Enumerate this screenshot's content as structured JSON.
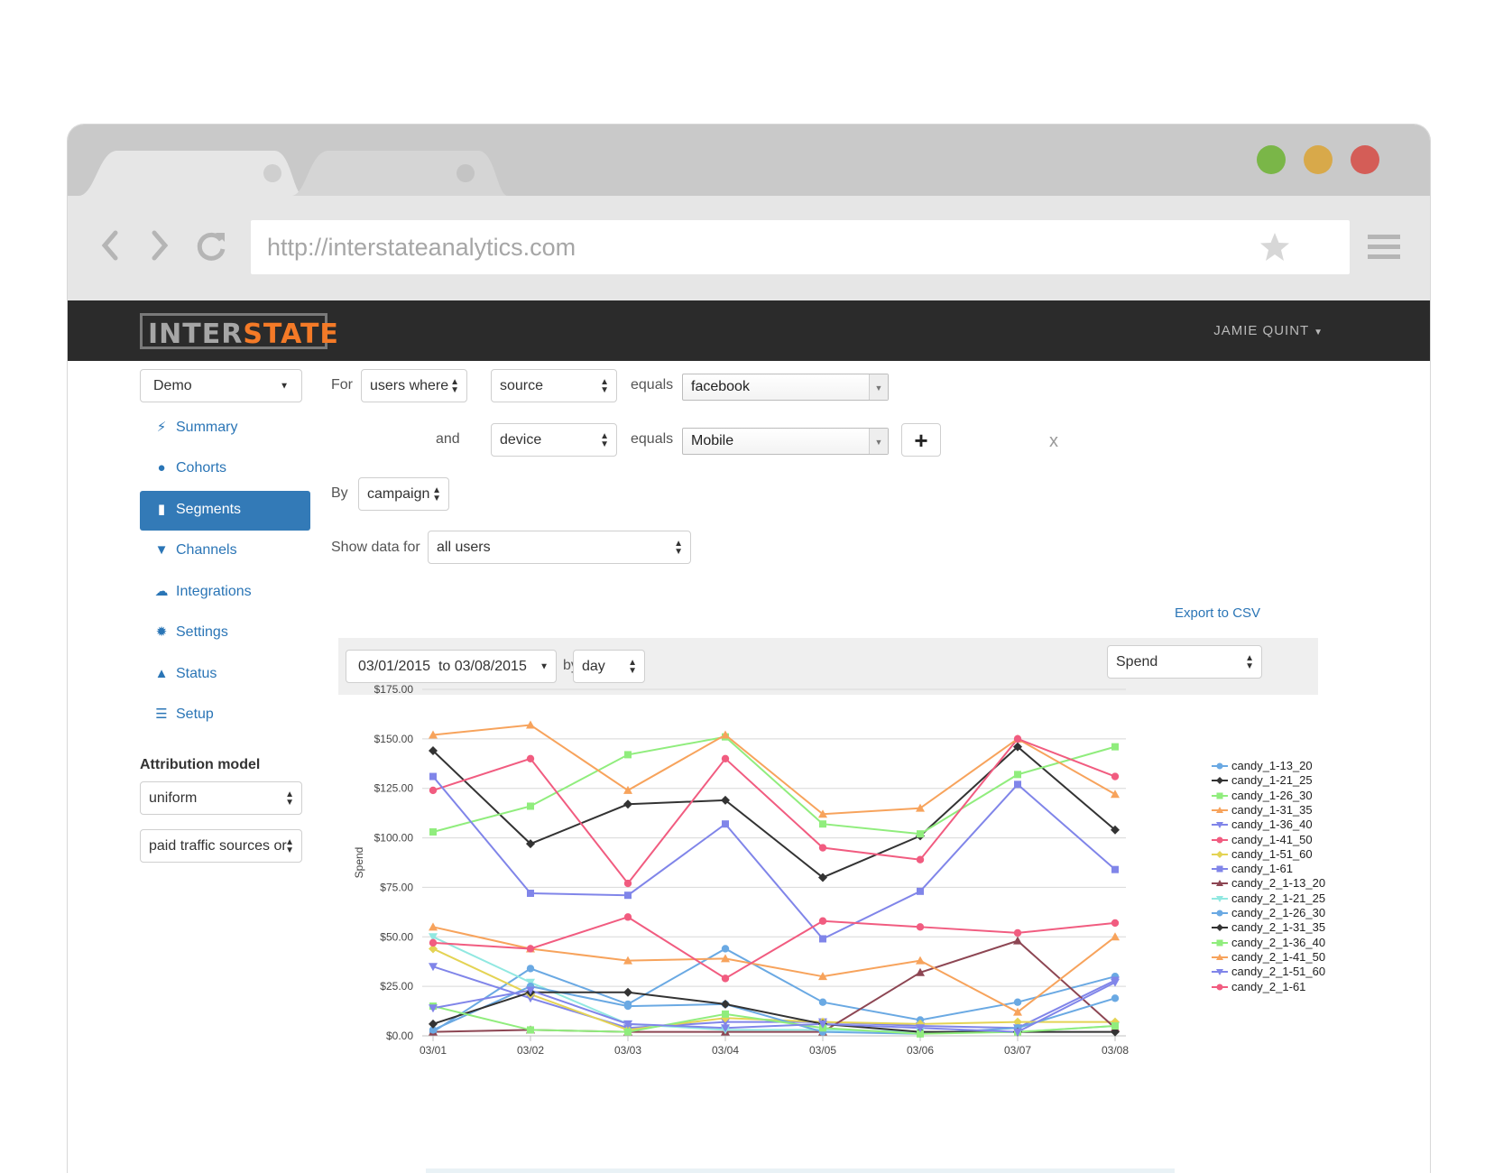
{
  "browser": {
    "url": "http://interstateanalytics.com",
    "traffic_lights": [
      "#7ab648",
      "#d8a94a",
      "#d45d57"
    ]
  },
  "app": {
    "logo_left": "INTER",
    "logo_right": "STATE",
    "logo_colors": {
      "left": "#a6a6a6",
      "right": "#f47a27"
    },
    "user_name": "JAMIE QUINT"
  },
  "sidebar": {
    "project": "Demo",
    "items": [
      {
        "label": "Summary",
        "icon": "bolt-icon",
        "active": false
      },
      {
        "label": "Cohorts",
        "icon": "user-icon",
        "active": false
      },
      {
        "label": "Segments",
        "icon": "bar-chart-icon",
        "active": true
      },
      {
        "label": "Channels",
        "icon": "funnel-icon",
        "active": false
      },
      {
        "label": "Integrations",
        "icon": "cloud-icon",
        "active": false
      },
      {
        "label": "Settings",
        "icon": "gear-icon",
        "active": false
      },
      {
        "label": "Status",
        "icon": "road-icon",
        "active": false
      },
      {
        "label": "Setup",
        "icon": "server-icon",
        "active": false
      }
    ],
    "attribution_title": "Attribution model",
    "attribution_model": "uniform",
    "traffic_filter": "paid traffic sources or"
  },
  "filters": {
    "for_label": "For",
    "users_where": "users where",
    "field1": "source",
    "equals1": "equals",
    "value1": "facebook",
    "and_label": "and",
    "field2": "device",
    "equals2": "equals",
    "value2": "Mobile",
    "add_symbol": "+",
    "remove_symbol": "x",
    "by_label": "By",
    "by_value": "campaign",
    "show_label": "Show data for",
    "show_value": "all users"
  },
  "chart_controls": {
    "export_label": "Export to CSV",
    "date_range": "03/01/2015  to 03/08/2015",
    "by_label": "by",
    "granularity": "day",
    "metric": "Spend"
  },
  "chart_data": {
    "type": "line",
    "ylabel": "Spend",
    "ylim": [
      0,
      175
    ],
    "y_ticks": [
      "$0.00",
      "$25.00",
      "$50.00",
      "$75.00",
      "$100.00",
      "$125.00",
      "$150.00",
      "$175.00"
    ],
    "categories": [
      "03/01",
      "03/02",
      "03/03",
      "03/04",
      "03/05",
      "03/06",
      "03/07",
      "03/08"
    ],
    "legend_position": "right",
    "series": [
      {
        "name": "candy_1-13_20",
        "color": "#6aa9e3",
        "marker": "circle",
        "values": [
          2,
          34,
          16,
          44,
          17,
          8,
          17,
          30
        ]
      },
      {
        "name": "candy_1-21_25",
        "color": "#333333",
        "marker": "diamond",
        "values": [
          144,
          97,
          117,
          119,
          80,
          101,
          146,
          104
        ]
      },
      {
        "name": "candy_1-26_30",
        "color": "#90ed7d",
        "marker": "square",
        "values": [
          103,
          116,
          142,
          151,
          107,
          102,
          132,
          146
        ]
      },
      {
        "name": "candy_1-31_35",
        "color": "#f7a35c",
        "marker": "triangle",
        "values": [
          152,
          157,
          124,
          152,
          112,
          115,
          150,
          122
        ]
      },
      {
        "name": "candy_1-36_40",
        "color": "#8085e9",
        "marker": "triangle-down",
        "values": [
          35,
          19,
          4,
          7,
          7,
          5,
          4,
          28
        ]
      },
      {
        "name": "candy_1-41_50",
        "color": "#f15c80",
        "marker": "circle",
        "values": [
          124,
          140,
          77,
          140,
          95,
          89,
          150,
          131
        ]
      },
      {
        "name": "candy_1-51_60",
        "color": "#e4d354",
        "marker": "diamond",
        "values": [
          44,
          21,
          3,
          9,
          7,
          6,
          7,
          7
        ]
      },
      {
        "name": "candy_1-61",
        "color": "#8085e9",
        "marker": "square",
        "values": [
          131,
          72,
          71,
          107,
          49,
          73,
          127,
          84
        ]
      },
      {
        "name": "candy_2_1-13_20",
        "color": "#8d4653",
        "marker": "triangle",
        "values": [
          2,
          3,
          2,
          2,
          2,
          32,
          48,
          4
        ]
      },
      {
        "name": "candy_2_1-21_25",
        "color": "#91e8e1",
        "marker": "triangle-down",
        "values": [
          50,
          27,
          6,
          3,
          3,
          2,
          2,
          5
        ]
      },
      {
        "name": "candy_2_1-26_30",
        "color": "#6aa9e3",
        "marker": "circle",
        "values": [
          3,
          25,
          15,
          16,
          2,
          1,
          4,
          19
        ]
      },
      {
        "name": "candy_2_1-31_35",
        "color": "#333333",
        "marker": "diamond",
        "values": [
          6,
          22,
          22,
          16,
          6,
          2,
          2,
          2
        ]
      },
      {
        "name": "candy_2_1-36_40",
        "color": "#90ed7d",
        "marker": "square",
        "values": [
          15,
          3,
          2,
          11,
          4,
          1,
          2,
          5
        ]
      },
      {
        "name": "candy_2_1-41_50",
        "color": "#f7a35c",
        "marker": "triangle",
        "values": [
          55,
          44,
          38,
          39,
          30,
          38,
          12,
          50
        ]
      },
      {
        "name": "candy_2_1-51_60",
        "color": "#8085e9",
        "marker": "triangle-down",
        "values": [
          14,
          23,
          6,
          4,
          6,
          4,
          2,
          27
        ]
      },
      {
        "name": "candy_2_1-61",
        "color": "#f15c80",
        "marker": "circle",
        "values": [
          47,
          44,
          60,
          29,
          58,
          55,
          52,
          57
        ]
      }
    ]
  }
}
